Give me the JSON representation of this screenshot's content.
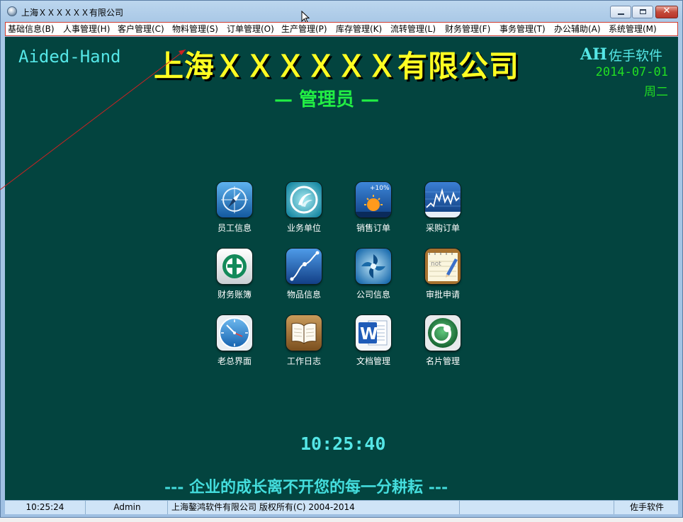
{
  "window": {
    "title": "上海ＸＸＸＸＸＸ有限公司",
    "close_glyph": "✕"
  },
  "menu": {
    "items": [
      {
        "label": "基础信息(B)"
      },
      {
        "label": "人事管理(H)"
      },
      {
        "label": "客户管理(C)"
      },
      {
        "label": "物料管理(S)"
      },
      {
        "label": "订单管理(O)"
      },
      {
        "label": "生产管理(P)"
      },
      {
        "label": "库存管理(K)"
      },
      {
        "label": "流转管理(L)"
      },
      {
        "label": "财务管理(F)"
      },
      {
        "label": "事务管理(T)"
      },
      {
        "label": "办公辅助(A)"
      },
      {
        "label": "系统管理(M)"
      }
    ]
  },
  "header": {
    "brand_left": "Aided-Hand",
    "company_name": "上海ＸＸＸＸＸＸ有限公司",
    "role": "— 管理员 —",
    "brand_right_ah": "AH",
    "brand_right_cn": "佐手软件",
    "date": "2014-07-01",
    "weekday": "周二"
  },
  "tiles": [
    {
      "label": "员工信息",
      "icon": "compass-icon"
    },
    {
      "label": "业务单位",
      "icon": "swirl-icon"
    },
    {
      "label": "销售订单",
      "icon": "weather-icon"
    },
    {
      "label": "采购订单",
      "icon": "stock-chart-icon"
    },
    {
      "label": "财务账簿",
      "icon": "bank-icon"
    },
    {
      "label": "物品信息",
      "icon": "curve-icon"
    },
    {
      "label": "公司信息",
      "icon": "aperture-icon"
    },
    {
      "label": "审批申请",
      "icon": "notepad-icon"
    },
    {
      "label": "老总界面",
      "icon": "clock-icon"
    },
    {
      "label": "工作日志",
      "icon": "book-icon"
    },
    {
      "label": "文档管理",
      "icon": "word-icon"
    },
    {
      "label": "名片管理",
      "icon": "contact-icon"
    }
  ],
  "footer": {
    "clock": "10:25:40",
    "slogan": "--- 企业的成长离不开您的每一分耕耘 ---"
  },
  "statusbar": {
    "time": "10:25:24",
    "user": "Admin",
    "copyright": "上海鏊鸿软件有限公司 版权所有(C) 2004-2014",
    "blank": "",
    "brand": "佐手软件"
  },
  "colors": {
    "background": "#03443f",
    "company_title": "#ffff22",
    "accent_cyan": "#55e6e6",
    "accent_green": "#22dd22"
  }
}
